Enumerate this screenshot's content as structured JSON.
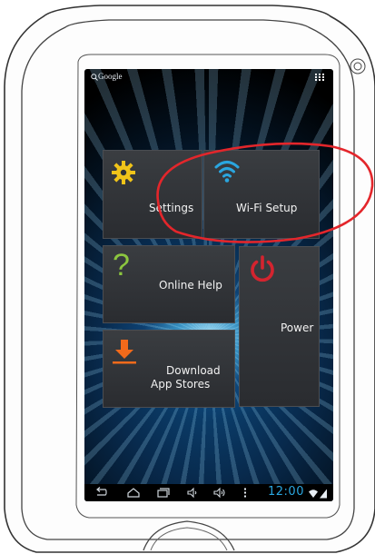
{
  "search": {
    "label": "Google"
  },
  "tiles": {
    "settings": {
      "label": "Settings"
    },
    "wifi": {
      "label": "Wi-Fi Setup"
    },
    "help": {
      "label": "Online Help"
    },
    "power": {
      "label": "Power"
    },
    "download": {
      "label_line1": "Download",
      "label_line2": "App Stores"
    }
  },
  "statusbar": {
    "time": "12:00"
  },
  "colors": {
    "accent_blue": "#2aa6df",
    "power_red": "#d4242f",
    "settings_yellow": "#f0c419",
    "help_green": "#8cc63f",
    "download_orange": "#f26a1b",
    "highlight_red": "#e3262b"
  },
  "icons": [
    "search-icon",
    "app-grid-icon",
    "gear-icon",
    "wifi-icon",
    "question-icon",
    "power-icon",
    "download-icon",
    "back-icon",
    "home-icon",
    "recent-apps-icon",
    "volume-down-icon",
    "volume-up-icon",
    "menu-icon",
    "wifi-status-icon",
    "battery-icon",
    "camera-icon"
  ]
}
